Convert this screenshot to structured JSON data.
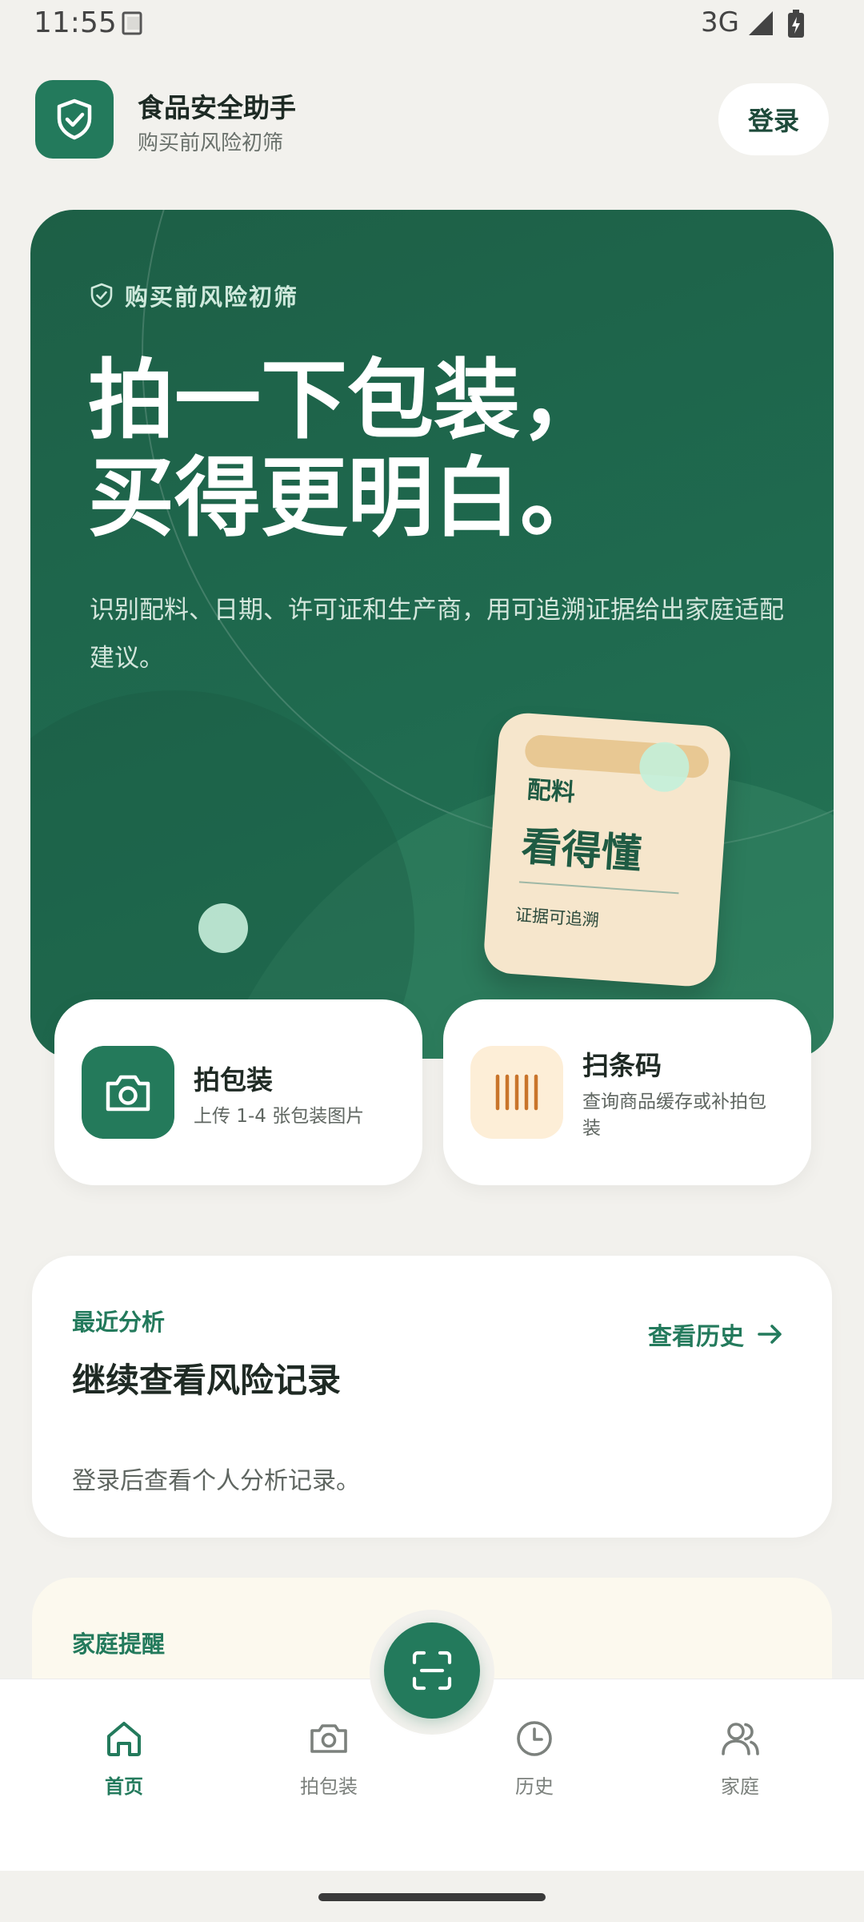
{
  "status_bar": {
    "time": "11:55",
    "network": "3G",
    "icons": [
      "sim-icon",
      "signal-icon",
      "battery-charging-icon"
    ]
  },
  "header": {
    "app_title": "食品安全助手",
    "app_subtitle": "购买前风险初筛",
    "login_label": "登录",
    "logo_icon": "shield-check-icon"
  },
  "hero": {
    "eyebrow": "购买前风险初筛",
    "title_line1": "拍一下包装，",
    "title_line2": "买得更明白。",
    "description": "识别配料、日期、许可证和生产商，用可追溯证据给出家庭适配建议。",
    "card": {
      "label": "配料",
      "headline": "看得懂",
      "footnote": "证据可追溯"
    }
  },
  "actions": {
    "photo": {
      "title": "拍包装",
      "description": "上传 1-4 张包装图片",
      "icon": "camera-icon"
    },
    "barcode": {
      "title": "扫条码",
      "description": "查询商品缓存或补拍包装",
      "icon": "barcode-icon"
    }
  },
  "recent": {
    "eyebrow": "最近分析",
    "title": "继续查看风险记录",
    "link_label": "查看历史",
    "empty_text": "登录后查看个人分析记录。"
  },
  "family": {
    "eyebrow": "家庭提醒"
  },
  "nav": {
    "items": [
      {
        "label": "首页",
        "icon": "home-icon",
        "active": true
      },
      {
        "label": "拍包装",
        "icon": "camera-icon",
        "active": false
      },
      {
        "label": "历史",
        "icon": "clock-icon",
        "active": false
      },
      {
        "label": "家庭",
        "icon": "users-icon",
        "active": false
      }
    ],
    "fab_icon": "scan-icon"
  },
  "colors": {
    "brand": "#237a5c",
    "hero_bg": "#1f6a4f",
    "page_bg": "#f2f1ed",
    "accent_warm": "#fdeed7",
    "barcode": "#c9742a"
  }
}
